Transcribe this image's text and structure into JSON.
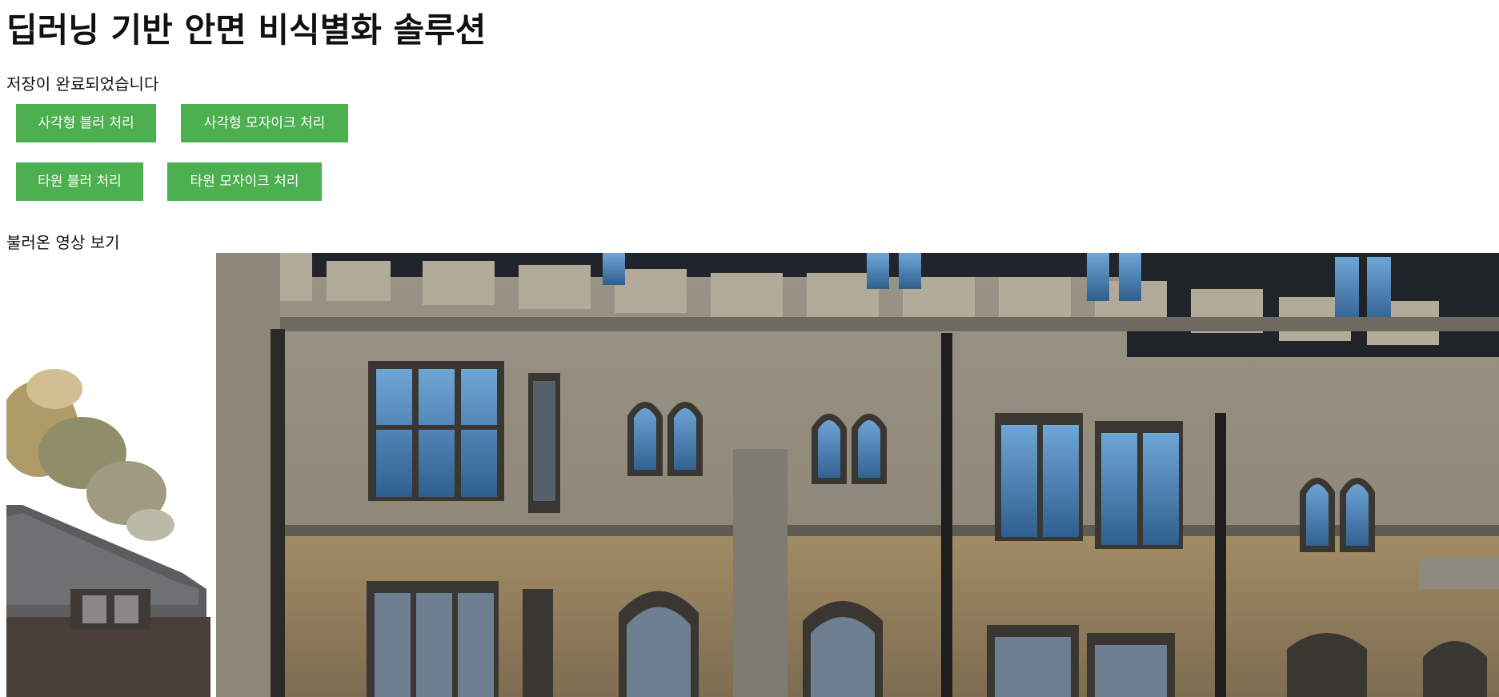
{
  "header": {
    "title": "딥러닝 기반 안면 비식별화 솔루션"
  },
  "status": {
    "message": "저장이 완료되었습니다"
  },
  "actions": {
    "rect_blur_label": "사각형 블러 처리",
    "rect_mosaic_label": "사각형 모자이크 처리",
    "ellipse_blur_label": "타원 블러 처리",
    "ellipse_mosaic_label": "타원 모자이크 처리"
  },
  "video": {
    "label": "불러온 영상 보기"
  },
  "colors": {
    "button_bg": "#4caf50",
    "button_text": "#ffffff"
  }
}
